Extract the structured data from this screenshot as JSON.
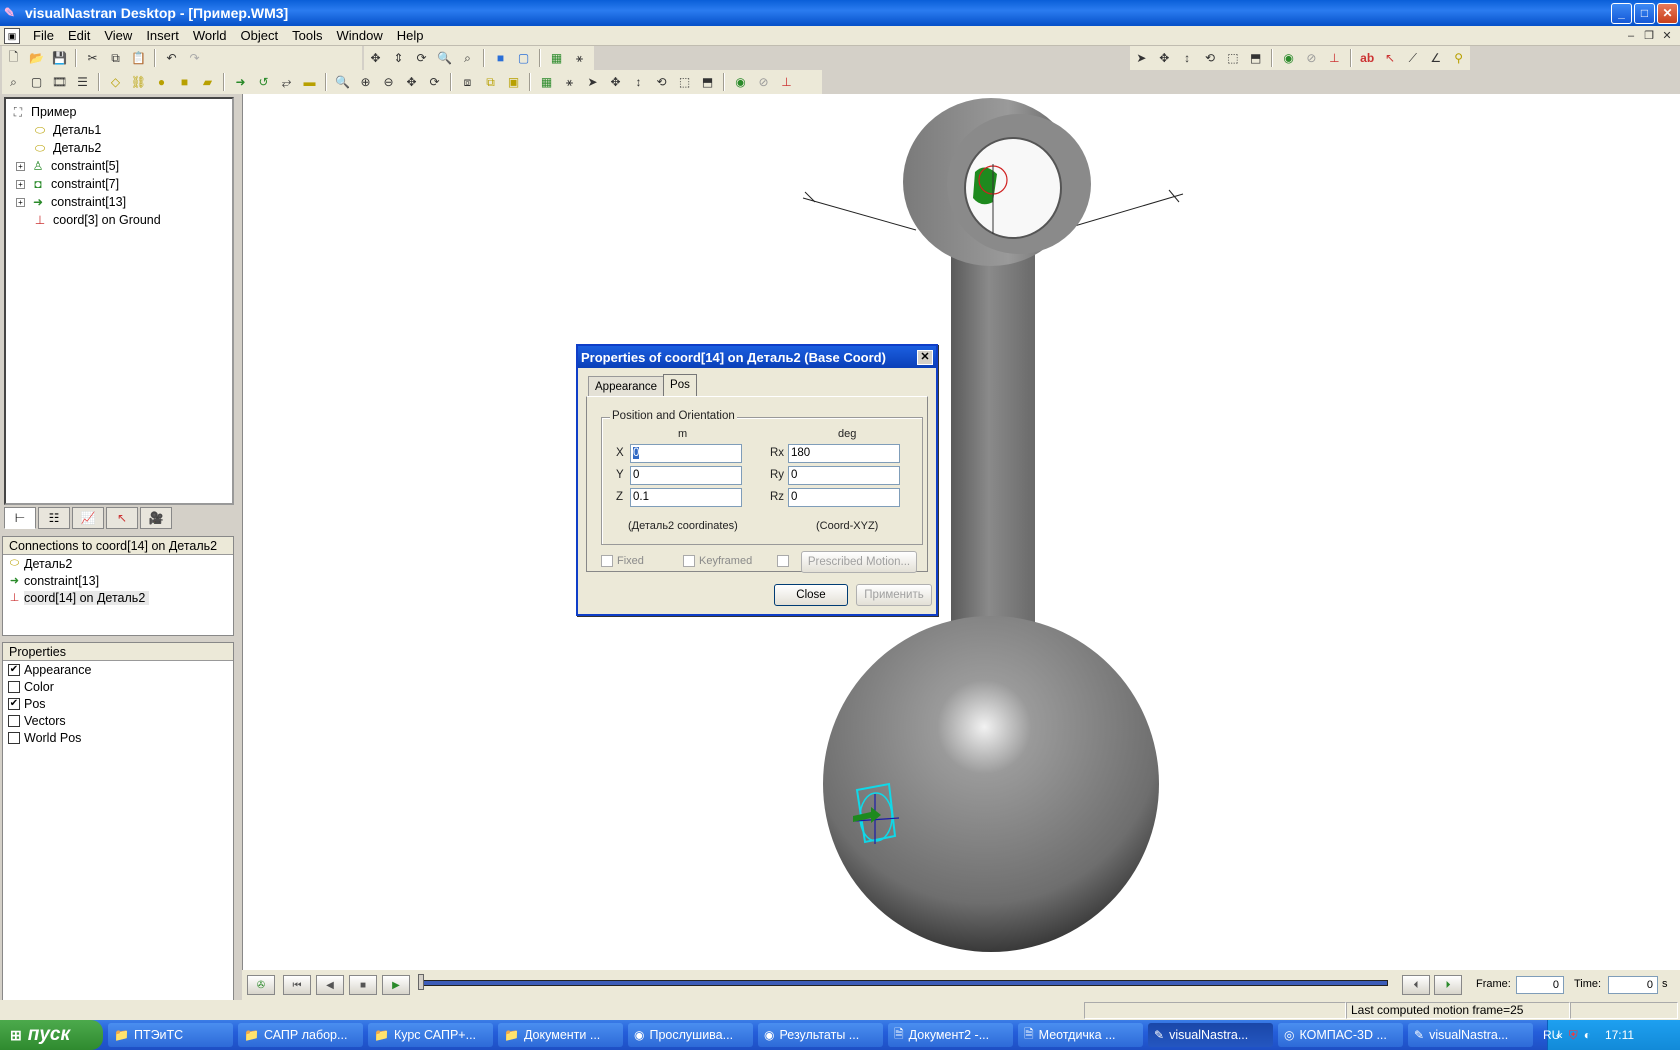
{
  "window": {
    "title": "visualNastran Desktop - [Пример.WM3]",
    "buttons": {
      "minimize": "_",
      "maximize": "□",
      "close": "✕"
    }
  },
  "menu": [
    "File",
    "Edit",
    "View",
    "Insert",
    "World",
    "Object",
    "Tools",
    "Window",
    "Help"
  ],
  "tree": {
    "root": "Пример",
    "items": [
      {
        "label": "Деталь1",
        "expandable": false
      },
      {
        "label": "Деталь2",
        "expandable": false
      },
      {
        "label": "constraint[5]",
        "expandable": true
      },
      {
        "label": "constraint[7]",
        "expandable": true
      },
      {
        "label": "constraint[13]",
        "expandable": true
      },
      {
        "label": "coord[3] on Ground",
        "expandable": false
      }
    ]
  },
  "connections": {
    "header": "Connections to coord[14] on Деталь2",
    "items": [
      "Деталь2",
      "constraint[13]",
      "coord[14] on Деталь2"
    ]
  },
  "properties": {
    "header": "Properties",
    "items": [
      {
        "label": "Appearance",
        "checked": true
      },
      {
        "label": "Color",
        "checked": false
      },
      {
        "label": "Pos",
        "checked": true
      },
      {
        "label": "Vectors",
        "checked": false
      },
      {
        "label": "World Pos",
        "checked": false
      }
    ]
  },
  "dialog": {
    "title": "Properties of coord[14] on Деталь2 (Base Coord)",
    "tabs": [
      "Appearance",
      "Pos"
    ],
    "group_label": "Position and Orientation",
    "unit_m": "m",
    "unit_deg": "deg",
    "fields": {
      "x_label": "X",
      "x_value": "0",
      "y_label": "Y",
      "y_value": "0",
      "z_label": "Z",
      "z_value": "0.1",
      "rx_label": "Rx",
      "rx_value": "180",
      "ry_label": "Ry",
      "ry_value": "0",
      "rz_label": "Rz",
      "rz_value": "0"
    },
    "left_coords_note": "(Деталь2 coordinates)",
    "right_coords_note": "(Coord-XYZ)",
    "fixed_label": "Fixed",
    "keyframed_label": "Keyframed",
    "prescribed_label": "Prescribed Motion...",
    "close_label": "Close",
    "apply_label": "Применить"
  },
  "timeline": {
    "frame_label": "Frame:",
    "frame_value": "0",
    "time_label": "Time:",
    "time_value": "0",
    "time_unit": "s"
  },
  "status": {
    "message": "Last computed motion frame=25"
  },
  "taskbar": {
    "start": "пуск",
    "tasks": [
      "ПТЭиТС",
      "САПР лабор...",
      "Курс САПР+...",
      "Документи ...",
      "Прослушива...",
      "Результаты ...",
      "Документ2 -...",
      "Меотдичка ...",
      "visualNastra...",
      "КОМПАС-3D ...",
      "visualNastra..."
    ],
    "language": "RU",
    "clock": "17:11"
  },
  "colors": {
    "titlebar": "#0a5fd8",
    "selection": "#316ac5",
    "body_gray": "#888888"
  }
}
